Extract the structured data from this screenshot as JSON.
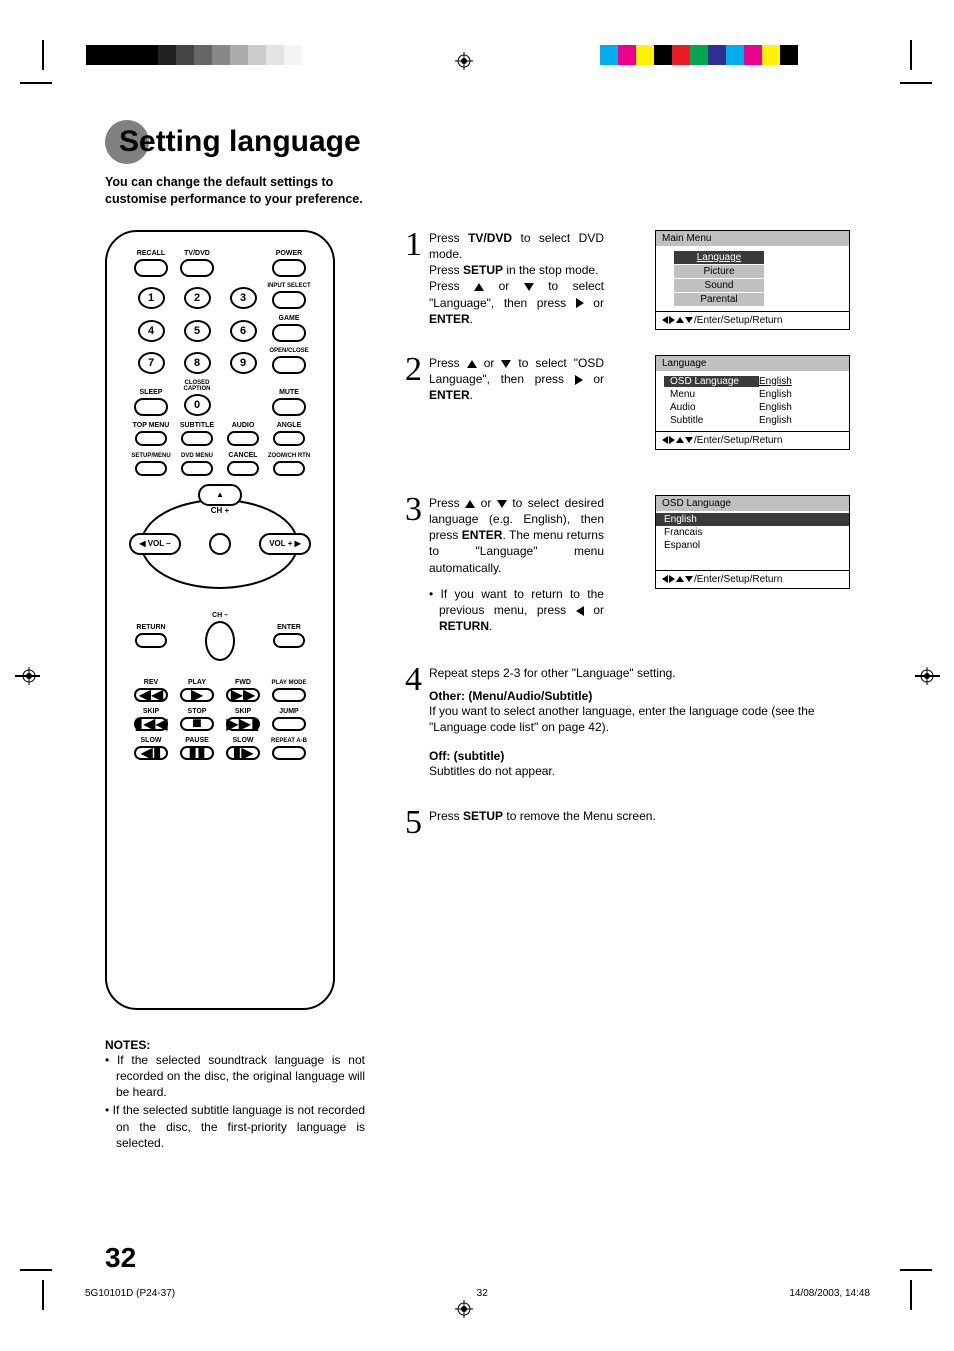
{
  "title": "Setting language",
  "intro": "You can change the default settings to customise performance to your preference.",
  "remote": {
    "r1": {
      "recall": "RECALL",
      "tvdvd": "TV/DVD",
      "power": "POWER"
    },
    "r2_right": "INPUT SELECT",
    "r3_right": "GAME",
    "r4_right": "OPEN/CLOSE",
    "r5": {
      "sleep": "SLEEP",
      "cc": "CLOSED\nCAPTION",
      "mute": "MUTE"
    },
    "r6": {
      "top": "TOP MENU",
      "sub": "SUBTITLE",
      "aud": "AUDIO",
      "ang": "ANGLE"
    },
    "r7": {
      "setup": "SETUP/MENU",
      "dvd": "DVD MENU",
      "can": "CANCEL",
      "zoom": "ZOOM/CH RTN"
    },
    "pad": {
      "chp": "CH +",
      "chm": "CH –",
      "volm": "VOL –",
      "volp": "VOL +"
    },
    "ret": {
      "ret": "RETURN",
      "ent": "ENTER"
    },
    "p1": {
      "rev": "REV",
      "play": "PLAY",
      "fwd": "FWD",
      "pm": "PLAY MODE"
    },
    "p2": {
      "s1": "SKIP",
      "stop": "STOP",
      "s2": "SKIP",
      "jump": "JUMP"
    },
    "p3": {
      "sl1": "SLOW",
      "pause": "PAUSE",
      "sl2": "SLOW",
      "rab": "REPEAT A-B"
    }
  },
  "notes_title": "NOTES:",
  "notes": [
    "If the selected soundtrack language is not recorded on the disc, the original language will be heard.",
    "If the selected subtitle language is not recorded on the disc, the first-priority language is selected."
  ],
  "steps": {
    "s1": {
      "l1a": "Press ",
      "l1b": "TV/DVD",
      "l1c": " to select DVD mode.",
      "l2a": "Press ",
      "l2b": "SETUP",
      "l2c": " in the stop mode.",
      "l3a": "Press ",
      "l3b": " or ",
      "l3c": " to select \"Language\", then press ",
      "l3d": " or ",
      "l3e": "ENTER",
      "l3f": "."
    },
    "s2": {
      "a": "Press ",
      "b": " or ",
      "c": " to select \"OSD Language\", then press ",
      "d": " or ",
      "e": "ENTER",
      "f": "."
    },
    "s3": {
      "a": "Press ",
      "b": " or ",
      "c": " to select desired language (e.g. English), then press ",
      "d": "ENTER",
      "e": ".",
      "f": "The menu returns to \"Language\" menu automatically.",
      "bullet": "If you want to return to the previous menu, press ",
      "bret": " or ",
      "bret2": "RETURN",
      "bret3": "."
    },
    "s4": {
      "a": "Repeat steps 2-3 for other \"Language\" setting.",
      "h1": "Other: (Menu/Audio/Subtitle)",
      "p1": "If you want to select another language, enter the language code (see the \"Language code list\" on page 42).",
      "h2": "Off: (subtitle)",
      "p2": "Subtitles do not appear."
    },
    "s5": {
      "a": "Press ",
      "b": "SETUP",
      "c": " to remove the Menu screen."
    }
  },
  "osd1": {
    "title": "Main Menu",
    "items": [
      "Language",
      "Picture",
      "Sound",
      "Parental"
    ],
    "footer": "/Enter/Setup/Return"
  },
  "osd2": {
    "title": "Language",
    "rows": [
      {
        "k": "OSD Language",
        "v": "English",
        "sel": true
      },
      {
        "k": "Menu",
        "v": "English"
      },
      {
        "k": "Audio",
        "v": "English"
      },
      {
        "k": "Subtitle",
        "v": "English"
      }
    ],
    "footer": "/Enter/Setup/Return"
  },
  "osd3": {
    "title": "OSD Language",
    "items": [
      "English",
      "Francais",
      "Espanol"
    ],
    "footer": "/Enter/Setup/Return"
  },
  "page_number": "32",
  "footer": {
    "file": "5G10101D (P24-37)",
    "page": "32",
    "date": "14/08/2003, 14:48"
  }
}
